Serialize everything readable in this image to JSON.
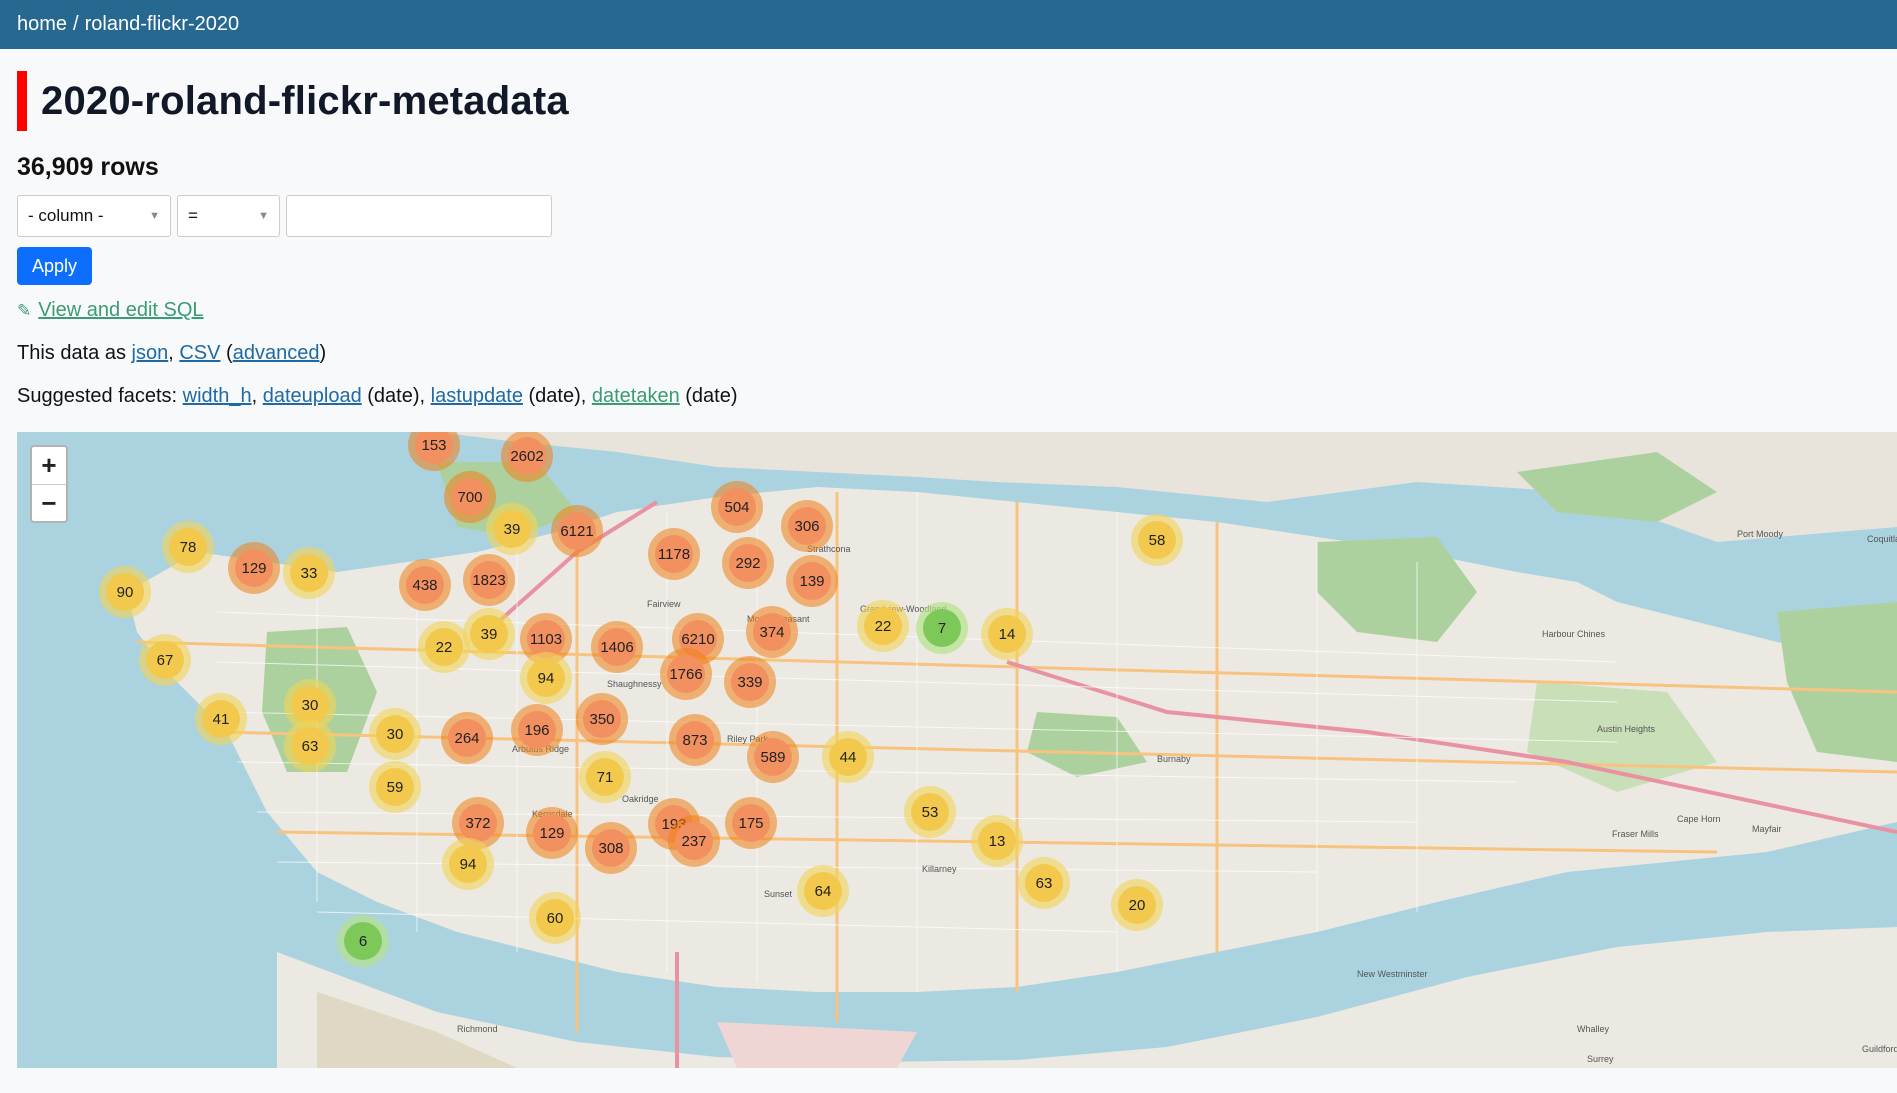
{
  "breadcrumb": {
    "home": "home",
    "separator": "/",
    "database": "roland-flickr-2020"
  },
  "page_title": "2020-roland-flickr-metadata",
  "row_count": "36,909 rows",
  "filter": {
    "column_select": "- column -",
    "operator_select": "=",
    "value_input": ""
  },
  "apply_label": "Apply",
  "sql_link": "View and edit SQL",
  "export": {
    "prefix": "This data as",
    "json": "json",
    "csv": "CSV",
    "open_paren": "(",
    "advanced": "advanced",
    "close_paren": ")"
  },
  "facets": {
    "prefix": "Suggested facets:",
    "items": [
      {
        "name": "width_h",
        "suffix": ","
      },
      {
        "name": "dateupload",
        "suffix": " (date),"
      },
      {
        "name": "lastupdate",
        "suffix": " (date),"
      },
      {
        "name": "datetaken",
        "suffix": " (date)"
      }
    ]
  },
  "zoom": {
    "in": "+",
    "out": "−"
  },
  "map_labels": [
    "Strathcona",
    "Fairview",
    "Mount Pleasant",
    "Shaughnessy",
    "Riley Park",
    "Oakridge",
    "Kerrisdale",
    "Arbutus Ridge",
    "Sunset",
    "Killarney",
    "Grandview-Woodland",
    "Burnaby",
    "New Westminster",
    "Richmond",
    "Port Moody",
    "Coquitlam",
    "Mayfair",
    "Cape Horn",
    "Fraser Mills",
    "Whalley",
    "Surrey",
    "Guildford",
    "Harbour Chines",
    "Austin Heights"
  ],
  "clusters": [
    {
      "count": "153",
      "size": "large"
    },
    {
      "count": "2602",
      "size": "large"
    },
    {
      "count": "700",
      "size": "large"
    },
    {
      "count": "39",
      "size": "medium"
    },
    {
      "count": "6121",
      "size": "large"
    },
    {
      "count": "504",
      "size": "large"
    },
    {
      "count": "306",
      "size": "large"
    },
    {
      "count": "1178",
      "size": "large"
    },
    {
      "count": "292",
      "size": "large"
    },
    {
      "count": "139",
      "size": "large"
    },
    {
      "count": "78",
      "size": "medium"
    },
    {
      "count": "129",
      "size": "large"
    },
    {
      "count": "33",
      "size": "medium"
    },
    {
      "count": "90",
      "size": "medium"
    },
    {
      "count": "438",
      "size": "large"
    },
    {
      "count": "1823",
      "size": "large"
    },
    {
      "count": "58",
      "size": "medium"
    },
    {
      "count": "22",
      "size": "medium"
    },
    {
      "count": "7",
      "size": "small"
    },
    {
      "count": "14",
      "size": "medium"
    },
    {
      "count": "374",
      "size": "large"
    },
    {
      "count": "6210",
      "size": "large"
    },
    {
      "count": "1406",
      "size": "large"
    },
    {
      "count": "1103",
      "size": "large"
    },
    {
      "count": "39",
      "size": "medium"
    },
    {
      "count": "22",
      "size": "medium"
    },
    {
      "count": "67",
      "size": "medium"
    },
    {
      "count": "94",
      "size": "medium"
    },
    {
      "count": "1766",
      "size": "large"
    },
    {
      "count": "339",
      "size": "large"
    },
    {
      "count": "41",
      "size": "medium"
    },
    {
      "count": "30",
      "size": "medium"
    },
    {
      "count": "63",
      "size": "medium"
    },
    {
      "count": "30",
      "size": "medium"
    },
    {
      "count": "264",
      "size": "large"
    },
    {
      "count": "196",
      "size": "large"
    },
    {
      "count": "350",
      "size": "large"
    },
    {
      "count": "873",
      "size": "large"
    },
    {
      "count": "589",
      "size": "large"
    },
    {
      "count": "44",
      "size": "medium"
    },
    {
      "count": "71",
      "size": "medium"
    },
    {
      "count": "59",
      "size": "medium"
    },
    {
      "count": "372",
      "size": "large"
    },
    {
      "count": "129",
      "size": "large"
    },
    {
      "count": "308",
      "size": "large"
    },
    {
      "count": "193",
      "size": "large"
    },
    {
      "count": "237",
      "size": "large"
    },
    {
      "count": "175",
      "size": "large"
    },
    {
      "count": "53",
      "size": "medium"
    },
    {
      "count": "13",
      "size": "medium"
    },
    {
      "count": "94",
      "size": "medium"
    },
    {
      "count": "64",
      "size": "medium"
    },
    {
      "count": "63",
      "size": "medium"
    },
    {
      "count": "20",
      "size": "medium"
    },
    {
      "count": "60",
      "size": "medium"
    },
    {
      "count": "6",
      "size": "small"
    }
  ]
}
